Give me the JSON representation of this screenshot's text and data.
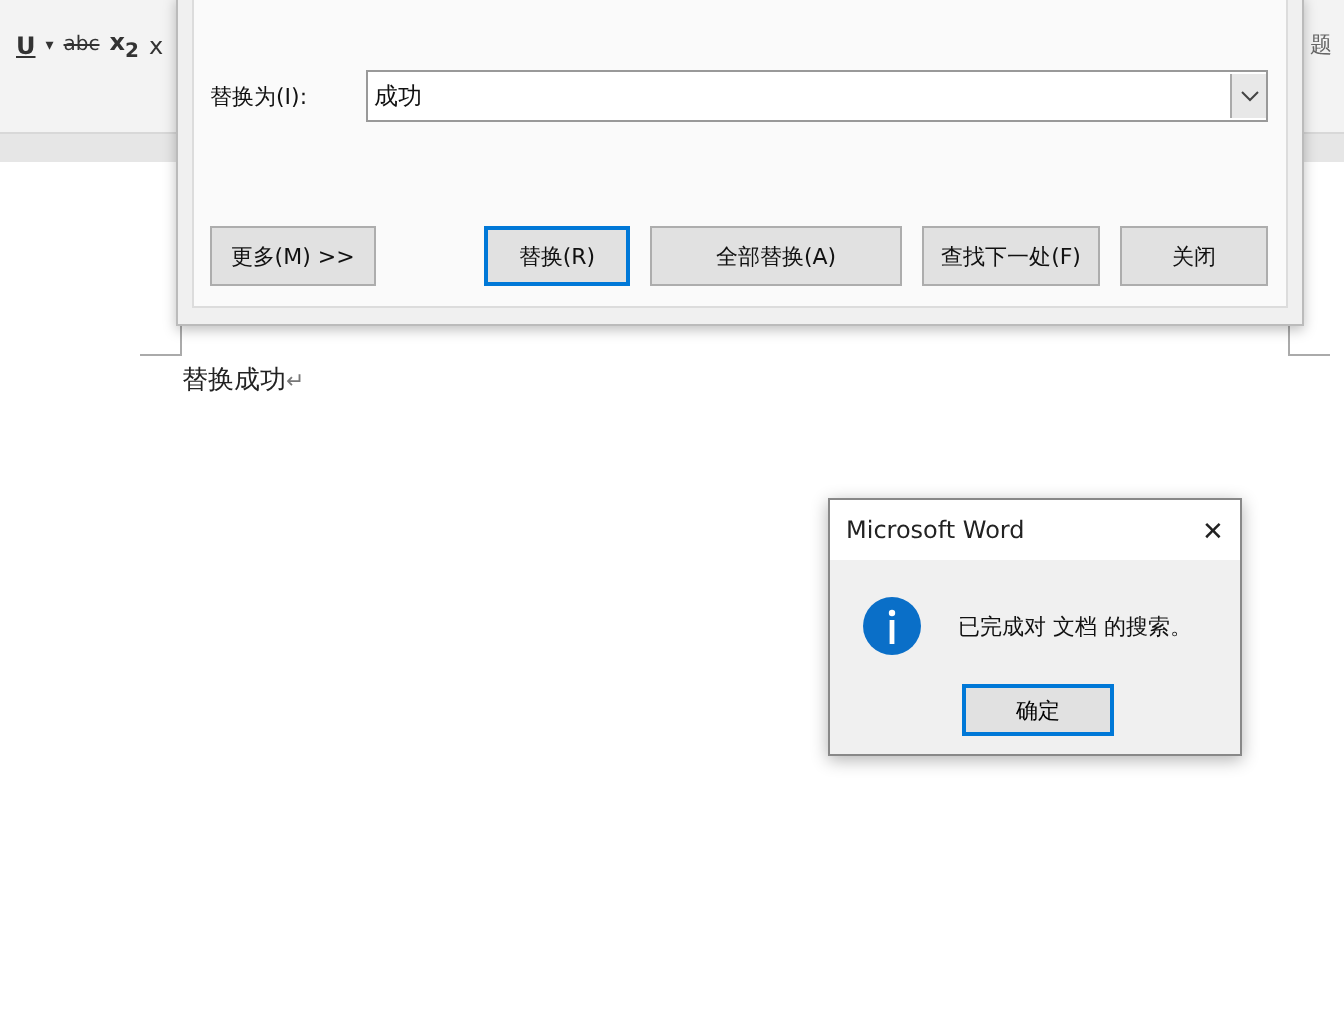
{
  "ribbon": {
    "buttons": [
      {
        "label": "U",
        "kind": "underline"
      },
      {
        "label": "▾",
        "kind": "caret"
      },
      {
        "label": "abc",
        "kind": "strike"
      },
      {
        "label": "x$_{2}$",
        "kind": "sub"
      },
      {
        "label": "x",
        "kind": "plain"
      }
    ],
    "style_label": "题"
  },
  "replace_dialog": {
    "replace_label": "替换为(I):",
    "replace_value": "成功",
    "buttons": [
      {
        "label": "更多(M) >>",
        "selected": false
      },
      {
        "label": "替换(R)",
        "selected": true
      },
      {
        "label": "全部替换(A)",
        "selected": false
      },
      {
        "label": "查找下一处(F)",
        "selected": false
      },
      {
        "label": "关闭",
        "selected": false
      }
    ]
  },
  "document": {
    "text": "替换成功",
    "paragraph_mark": "↵"
  },
  "message_box": {
    "title": "Microsoft Word",
    "close": "✕",
    "message": "已完成对 文档 的搜索。",
    "ok": "确定"
  }
}
